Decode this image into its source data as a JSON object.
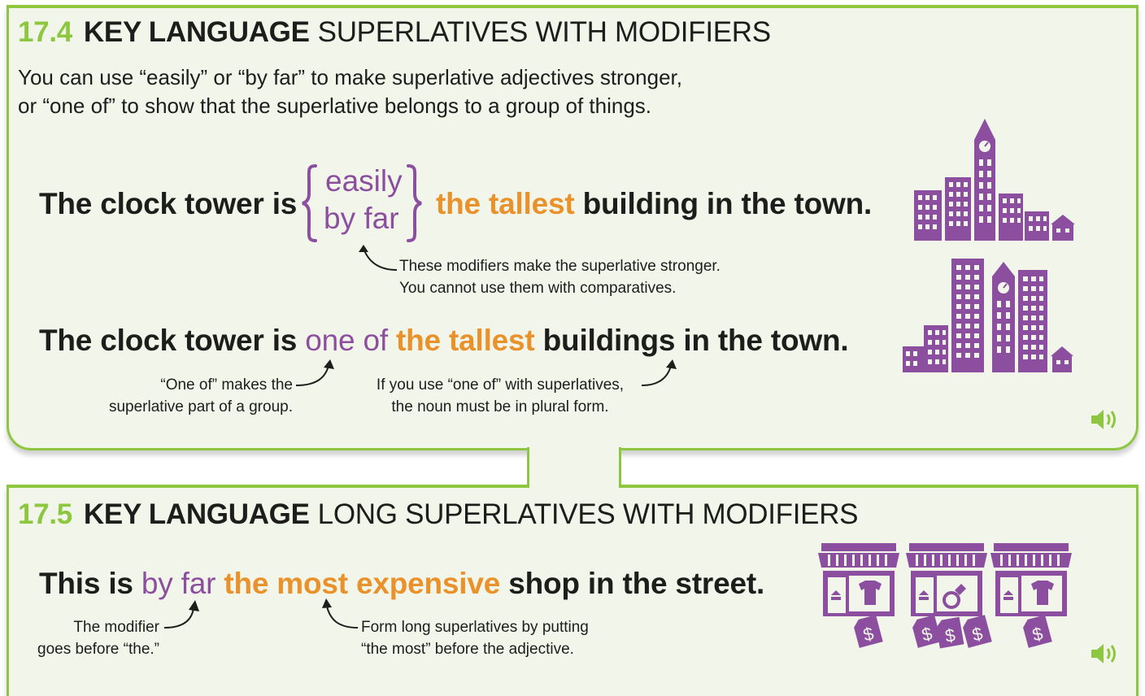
{
  "section1": {
    "number": "17.4",
    "key_label": "KEY LANGUAGE",
    "subtitle": "SUPERLATIVES WITH MODIFIERS",
    "intro": [
      "You can use “easily” or “by far” to make superlative adjectives stronger,",
      "or “one of” to show that the superlative belongs to a group of things."
    ],
    "example1": {
      "start": "The clock tower is",
      "options": [
        "easily",
        "by far"
      ],
      "superlative": "the tallest",
      "end": "building in the town.",
      "note": [
        "These modifiers make the superlative stronger.",
        "You cannot use them with comparatives."
      ]
    },
    "example2": {
      "start": "The clock tower is",
      "modifier": "one of",
      "superlative": "the tallest",
      "end": "buildings in the town.",
      "note_left": [
        "“One of” makes the",
        "superlative part of a group."
      ],
      "note_right": [
        "If you use “one of” with superlatives,",
        "the noun must be in plural form."
      ]
    },
    "icons": [
      "town-skyline-icon",
      "city-skyline-icon",
      "speaker-icon"
    ]
  },
  "section2": {
    "number": "17.5",
    "key_label": "KEY LANGUAGE",
    "subtitle": "LONG SUPERLATIVES WITH MODIFIERS",
    "example": {
      "start": "This is",
      "modifier": "by far",
      "superlative": "the most expensive",
      "end": "shop in the street.",
      "note_left": [
        "The modifier",
        "goes before “the.”"
      ],
      "note_right": [
        "Form long superlatives by putting",
        "“the most” before the adjective."
      ]
    },
    "icons": [
      "clothes-shop-icon",
      "jewelry-shop-icon",
      "clothes-shop-icon",
      "speaker-icon"
    ]
  },
  "colors": {
    "accent_green": "#8dc63f",
    "modifier_purple": "#8c4f9f",
    "superlative_orange": "#e9922b",
    "panel_background": "#f2f6ea"
  }
}
